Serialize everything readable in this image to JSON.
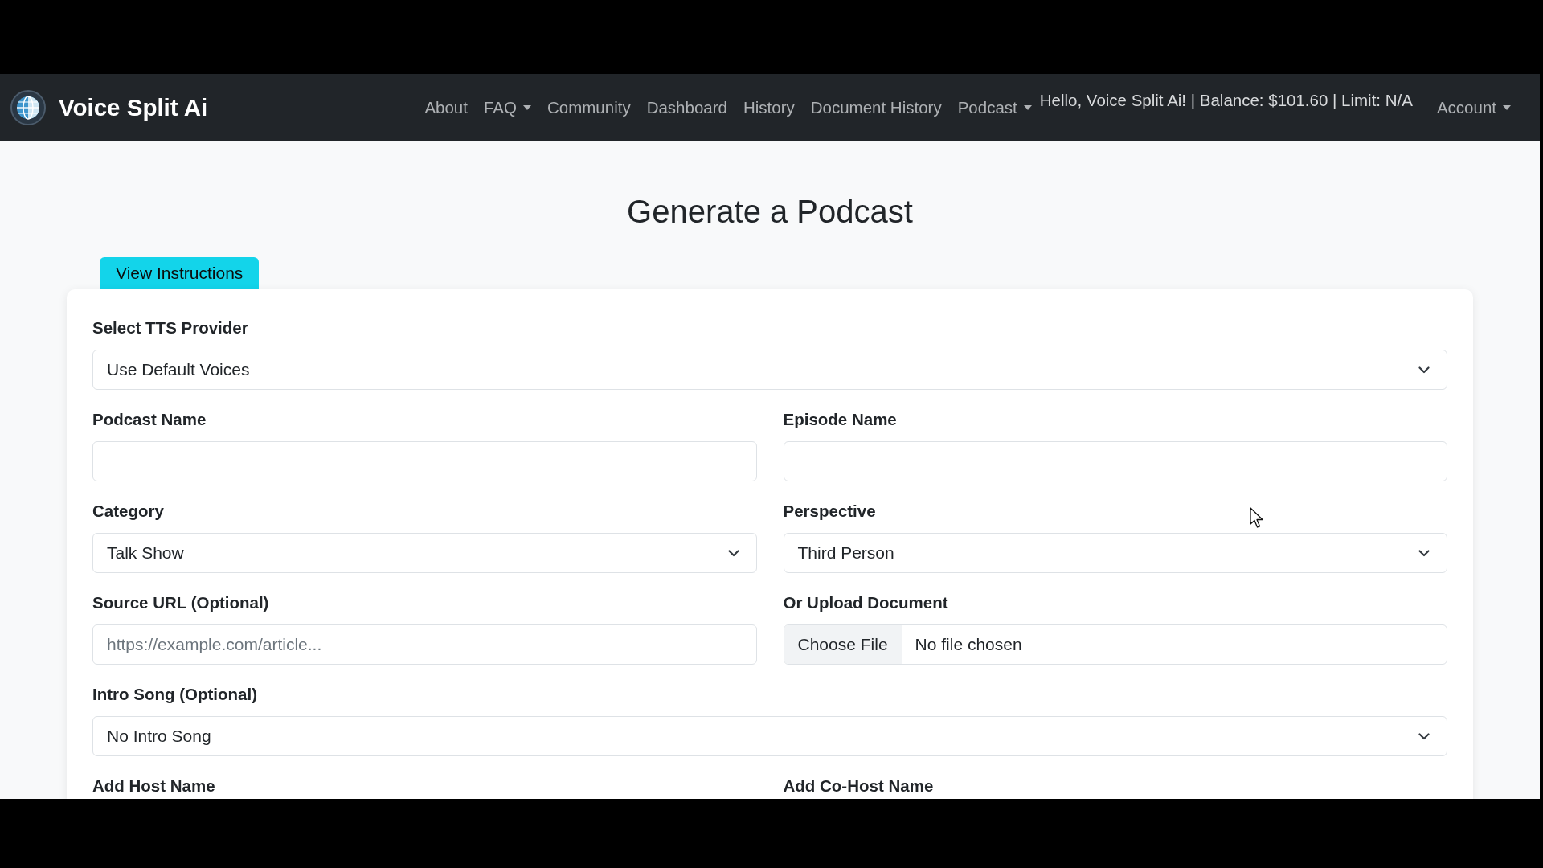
{
  "navbar": {
    "brand": "Voice Split Ai",
    "links": [
      {
        "label": "About",
        "dropdown": false
      },
      {
        "label": "FAQ",
        "dropdown": true
      },
      {
        "label": "Community",
        "dropdown": false
      },
      {
        "label": "Dashboard",
        "dropdown": false
      },
      {
        "label": "History",
        "dropdown": false
      },
      {
        "label": "Document History",
        "dropdown": false
      },
      {
        "label": "Podcast",
        "dropdown": true
      }
    ],
    "greeting": "Hello, Voice Split Ai! | Balance: $101.60 | Limit: N/A",
    "account": {
      "label": "Account",
      "dropdown": true
    }
  },
  "page": {
    "title": "Generate a Podcast",
    "instructions_button": "View Instructions"
  },
  "form": {
    "rows": [
      [
        {
          "kind": "select",
          "label": "Select TTS Provider",
          "value": "Use Default Voices"
        }
      ],
      [
        {
          "kind": "text",
          "label": "Podcast Name"
        },
        {
          "kind": "text",
          "label": "Episode Name"
        }
      ],
      [
        {
          "kind": "select",
          "label": "Category",
          "value": "Talk Show"
        },
        {
          "kind": "select",
          "label": "Perspective",
          "value": "Third Person"
        }
      ],
      [
        {
          "kind": "text",
          "label": "Source URL (Optional)",
          "placeholder": "https://example.com/article..."
        },
        {
          "kind": "file",
          "label": "Or Upload Document",
          "button": "Choose File",
          "status": "No file chosen"
        }
      ],
      [
        {
          "kind": "select",
          "label": "Intro Song (Optional)",
          "value": "No Intro Song"
        }
      ],
      [
        {
          "kind": "label",
          "label": "Add Host Name"
        },
        {
          "kind": "label",
          "label": "Add Co-Host Name"
        }
      ]
    ]
  }
}
